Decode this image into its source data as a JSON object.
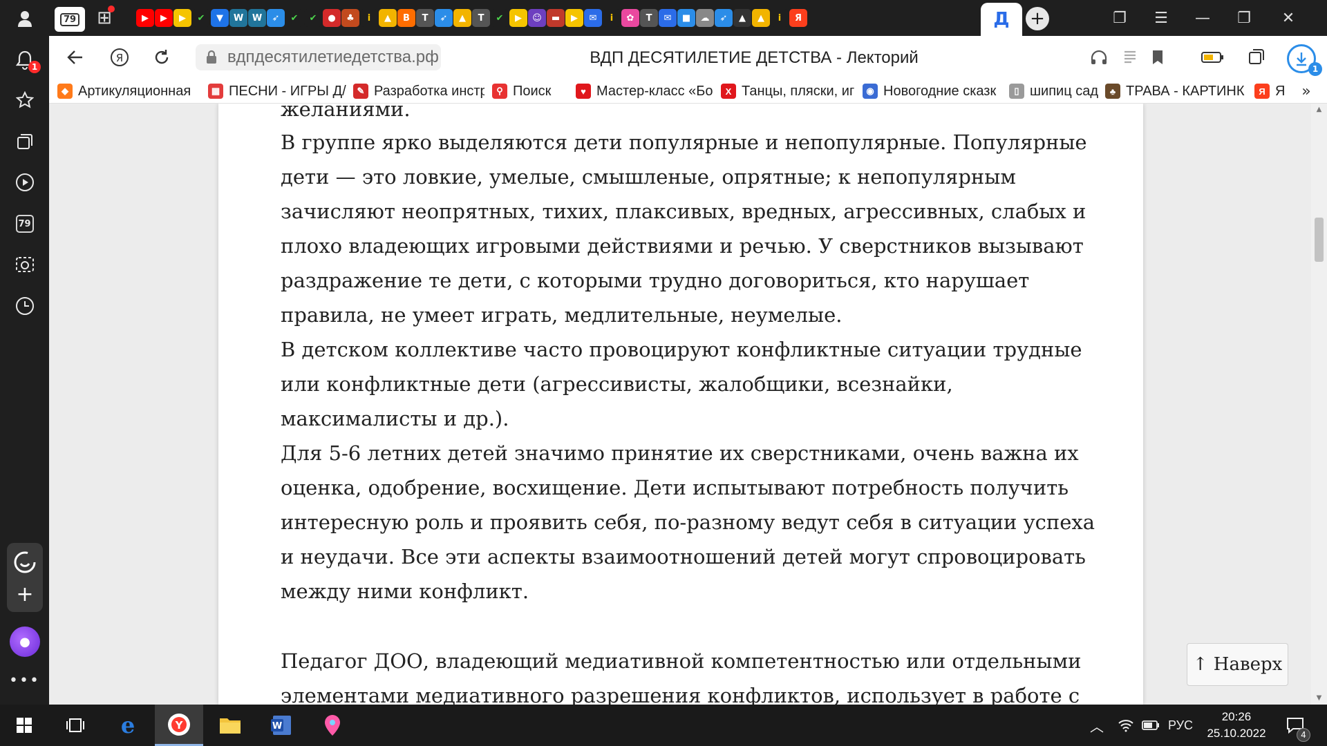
{
  "sidebar": {
    "notification_badge": "1",
    "tabs_counter": "79"
  },
  "tabs": {
    "counter": "79",
    "active_letter": "Д",
    "favicons": [
      "youtube",
      "youtube",
      "play",
      "check",
      "shield",
      "wordpress",
      "wordpress",
      "bird",
      "check",
      "check",
      "apple",
      "game",
      "info",
      "photo",
      "blogger",
      "text",
      "bird",
      "photo",
      "text",
      "check",
      "play",
      "person",
      "car",
      "play",
      "mail",
      "info",
      "flower",
      "text",
      "mail",
      "chat",
      "cloud",
      "bird",
      "mountain",
      "photo",
      "info",
      "yandex"
    ]
  },
  "address": {
    "url": "вдпдесятилетиедетства.рф",
    "page_title": "ВДП ДЕСЯТИЛЕТИЕ ДЕТСТВА - Лекторий",
    "downloads_badge": "1"
  },
  "bookmarks": [
    {
      "label": "Артикуляционная",
      "icon": "brush-icon",
      "color": "#ff7a1a"
    },
    {
      "label": "ПЕСНИ - ИГРЫ Д/",
      "icon": "games-icon",
      "color": "#e33c3c"
    },
    {
      "label": "Разработка инстр",
      "icon": "dev-icon",
      "color": "#d42a2a"
    },
    {
      "label": "Поиск",
      "icon": "yandex-search-icon",
      "color": "#e83232"
    },
    {
      "label": "Мастер-класс «Бо",
      "icon": "heart-icon",
      "color": "#e0171c"
    },
    {
      "label": "Танцы, пляски, иг",
      "icon": "x-icon",
      "color": "#e0171c"
    },
    {
      "label": "Новогодние сказк",
      "icon": "owl-icon",
      "color": "#3a6bd4"
    },
    {
      "label": "шипиц сад",
      "icon": "file-icon",
      "color": "#9a9a9a"
    },
    {
      "label": "ТРАВА - КАРТИНК",
      "icon": "tree-icon",
      "color": "#6a4a2a"
    },
    {
      "label": "Я",
      "icon": "yandex-icon",
      "color": "#fc3f1d"
    }
  ],
  "article": {
    "paragraphs": [
      "желаниями.",
      "В группе ярко выделяются дети популярные и непопулярные. Популярные дети — это ловкие, умелые, смышленые, опрятные; к непопулярным зачисляют неопрятных, тихих, плаксивых, вредных, агрессивных, слабых и плохо владеющих игровыми действиями и речью. У сверстников вызывают раздражение те дети, с которыми трудно договориться, кто нарушает правила, не умеет играть, медлительные, неумелые.",
      "В детском коллективе часто провоцируют конфликтные ситуации трудные или конфликтные дети (агрессивисты, жалобщики, всезнайки, максималисты и др.).",
      "Для 5-6 летних детей значимо принятие их сверстниками, очень важна их оценка, одобрение, восхищение. Дети испытывают потребность получить интересную роль и проявить себя, по-разному ведут себя в ситуации успеха и неудачи. Все эти аспекты взаимоотношений детей могут спровоцировать между ними конфликт.",
      "Педагог ДОО, владеющий медиативной компетентностью или отдельными элементами медиативного разрешения конфликтов, использует в работе с"
    ],
    "scroll_top_label": "↑ Наверх"
  },
  "taskbar": {
    "language": "РУС",
    "time": "20:26",
    "date": "25.10.2022",
    "notifications": "4"
  },
  "colors": {
    "accent": "#2b8de8",
    "sidebar_bg": "#1f1f1f",
    "taskbar_bg": "#1a1a1a"
  }
}
